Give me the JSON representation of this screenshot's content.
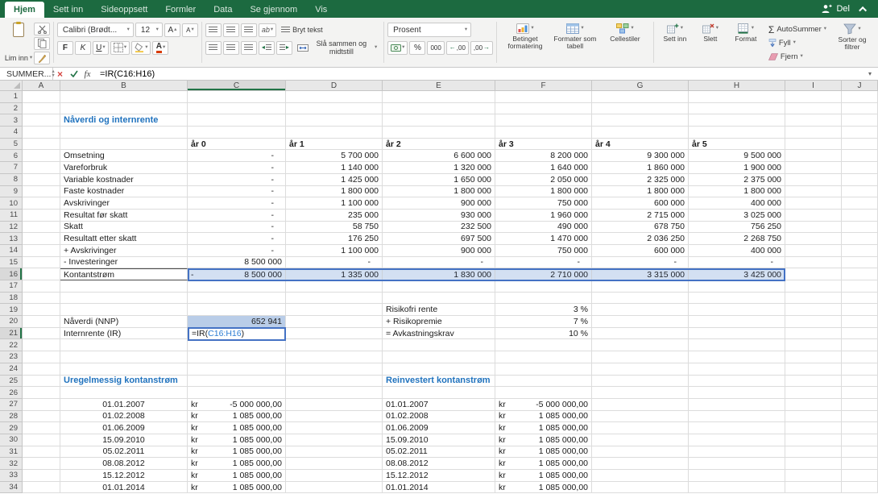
{
  "tabs": [
    {
      "label": "Hjem",
      "active": true
    },
    {
      "label": "Sett inn"
    },
    {
      "label": "Sideoppsett"
    },
    {
      "label": "Formler"
    },
    {
      "label": "Data"
    },
    {
      "label": "Se gjennom"
    },
    {
      "label": "Vis"
    }
  ],
  "share": {
    "label": "Del"
  },
  "ribbon": {
    "paste": "Lim inn",
    "font_name": "Calibri (Brødt...",
    "font_size": "12",
    "bold": "F",
    "italic": "K",
    "underline": "U",
    "wrap_text": "Bryt tekst",
    "merge_center": "Slå sammen og midtstill",
    "number_format": "Prosent",
    "percent": "%",
    "thousands": "000",
    "conditional": "Betinget formatering",
    "format_table": "Formater som tabell",
    "cell_styles": "Cellestiler",
    "insert": "Sett inn",
    "delete": "Slett",
    "format": "Format",
    "autosum": "AutoSummer",
    "fill": "Fyll",
    "clear": "Fjern",
    "sort_filter": "Sorter og filtrer"
  },
  "formula_bar": {
    "name_box": "SUMMER...",
    "fx": "fx",
    "formula": "=IR(C16:H16)"
  },
  "sheet": {
    "col_letters": [
      "A",
      "B",
      "C",
      "D",
      "E",
      "F",
      "G",
      "H",
      "I",
      "J"
    ],
    "visible_rows": 34,
    "title": "Nåverdi og internrente",
    "year_headers": [
      "år 0",
      "år 1",
      "år 2",
      "år 3",
      "år 4",
      "år 5"
    ],
    "pl_rows": [
      {
        "label": "Omsetning",
        "values": [
          "-",
          "5 700 000",
          "6 600 000",
          "8 200 000",
          "9 300 000",
          "9 500 000"
        ]
      },
      {
        "label": "Vareforbruk",
        "values": [
          "-",
          "1 140 000",
          "1 320 000",
          "1 640 000",
          "1 860 000",
          "1 900 000"
        ]
      },
      {
        "label": "Variable kostnader",
        "values": [
          "-",
          "1 425 000",
          "1 650 000",
          "2 050 000",
          "2 325 000",
          "2 375 000"
        ]
      },
      {
        "label": "Faste kostnader",
        "values": [
          "-",
          "1 800 000",
          "1 800 000",
          "1 800 000",
          "1 800 000",
          "1 800 000"
        ]
      },
      {
        "label": "Avskrivinger",
        "values": [
          "-",
          "1 100 000",
          "900 000",
          "750 000",
          "600 000",
          "400 000"
        ]
      },
      {
        "label": "Resultat før skatt",
        "values": [
          "-",
          "235 000",
          "930 000",
          "1 960 000",
          "2 715 000",
          "3 025 000"
        ]
      },
      {
        "label": "Skatt",
        "values": [
          "-",
          "58 750",
          "232 500",
          "490 000",
          "678 750",
          "756 250"
        ]
      },
      {
        "label": "Resultatt etter skatt",
        "values": [
          "-",
          "176 250",
          "697 500",
          "1 470 000",
          "2 036 250",
          "2 268 750"
        ]
      },
      {
        "label": "+ Avskrivinger",
        "values": [
          "-",
          "1 100 000",
          "900 000",
          "750 000",
          "600 000",
          "400 000"
        ]
      },
      {
        "label": "- Investeringer",
        "values": [
          "8 500 000",
          "-",
          "-",
          "-",
          "-",
          "-"
        ]
      }
    ],
    "cashflow": {
      "label": "Kontantstrøm",
      "negative": "8 500 000",
      "values": [
        "1 335 000",
        "1 830 000",
        "2 710 000",
        "3 315 000",
        "3 425 000"
      ]
    },
    "npv": {
      "label": "Nåverdi (NNP)",
      "value": "652 941"
    },
    "irr": {
      "label": "Internrente (IR)",
      "formula_prefix": "=IR(",
      "formula_ref": "C16:H16",
      "formula_suffix": ")"
    },
    "rates": [
      {
        "label": "Risikofri rente",
        "value": "3 %"
      },
      {
        "label": "+ Risikopremie",
        "value": "7 %"
      },
      {
        "label": "= Avkastningskrav",
        "value": "10 %"
      }
    ],
    "irregular": {
      "title": "Uregelmessig kontanstrøm"
    },
    "reinvested": {
      "title": "Reinvestert kontanstrøm"
    },
    "currency": "kr",
    "dates": [
      "01.01.2007",
      "01.02.2008",
      "01.06.2009",
      "15.09.2010",
      "05.02.2011",
      "08.08.2012",
      "15.12.2012",
      "01.01.2014"
    ],
    "amounts": [
      "-5 000 000,00",
      "1 085 000,00",
      "1 085 000,00",
      "1 085 000,00",
      "1 085 000,00",
      "1 085 000,00",
      "1 085 000,00",
      "1 085 000,00"
    ]
  },
  "colors": {
    "ribbon_green": "#1c6a40",
    "accent_green": "#217346",
    "selection_blue": "#4472c4",
    "title_blue": "#2173be"
  }
}
